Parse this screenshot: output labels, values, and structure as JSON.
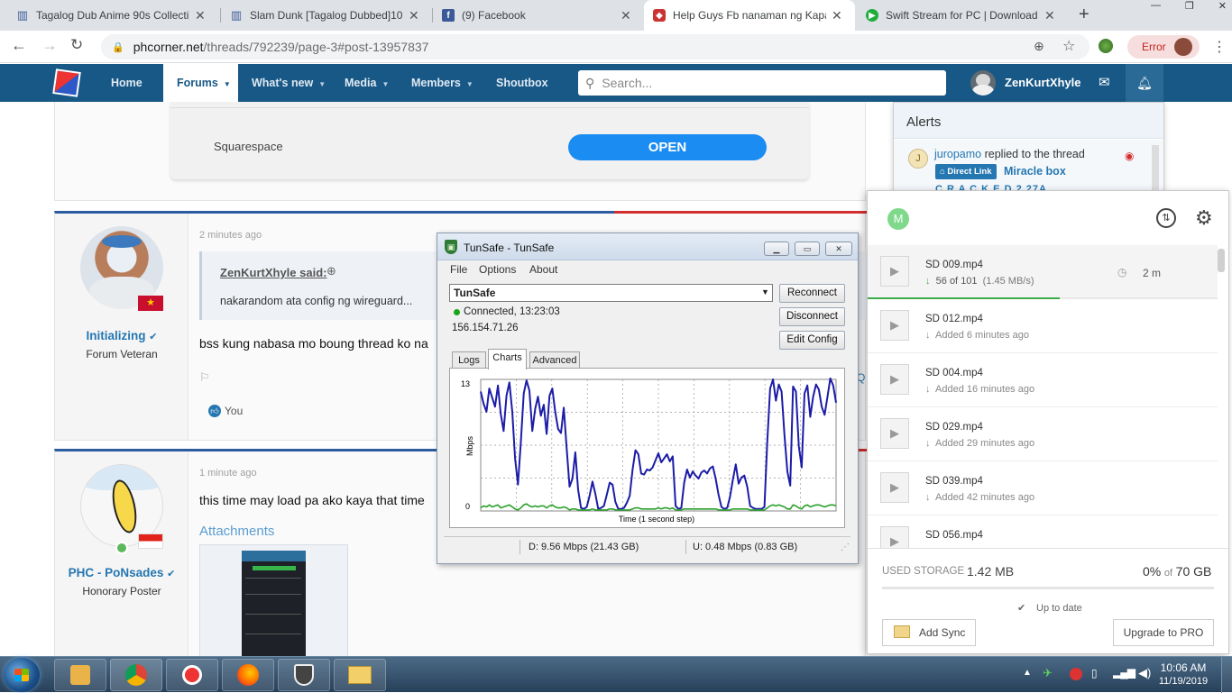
{
  "browser": {
    "tabs": [
      {
        "title": "Tagalog Dub Anime 90s Collecti",
        "icon": "mf-icon"
      },
      {
        "title": "Slam Dunk [Tagalog Dubbed]10",
        "icon": "mf-icon"
      },
      {
        "title": "(9) Facebook",
        "icon": "facebook-icon"
      },
      {
        "title": "Help Guys Fb nanaman ng Kapa",
        "icon": "phcorner-icon"
      },
      {
        "title": "Swift Stream for PC | Download",
        "icon": "swift-stream-icon"
      }
    ],
    "url_domain": "phcorner.net",
    "url_path": "/threads/792239/page-3#post-13957837",
    "error_label": "Error"
  },
  "site_nav": {
    "items": [
      "Home",
      "Forums",
      "What's new",
      "Media",
      "Members",
      "Shoutbox"
    ],
    "search_placeholder": "Search...",
    "username": "ZenKurtXhyle"
  },
  "ad": {
    "brand": "Squarespace",
    "button": "OPEN"
  },
  "posts": [
    {
      "username": "Initializing",
      "user_title": "Forum Veteran",
      "time": "2 minutes ago",
      "quote_author": "ZenKurtXhyle said:",
      "quote_text": "nakarandom ata config ng wireguard...",
      "body": "bss kung nabasa mo boung thread ko na",
      "reaction": "You",
      "overflow_char": "Q"
    },
    {
      "username": "PHC - PoNsades",
      "user_title": "Honorary Poster",
      "time": "1 minute ago",
      "body": "this time may load pa ako kaya that time",
      "attachments_label": "Attachments"
    }
  ],
  "alerts": {
    "title": "Alerts",
    "user": "juropamo",
    "action": "replied to the thread",
    "badge": "Direct Link",
    "thread": "Miracle box",
    "thread_cont": "C R A C K E D 2.27A"
  },
  "tunsafe": {
    "title": "TunSafe - TunSafe",
    "menu": [
      "File",
      "Options",
      "About"
    ],
    "config": "TunSafe",
    "status": "Connected, 13:23:03",
    "ip": "156.154.71.26",
    "buttons": [
      "Reconnect",
      "Disconnect",
      "Edit Config"
    ],
    "tabs": [
      "Logs",
      "Charts",
      "Advanced"
    ],
    "download": "D: 9.56 Mbps (21.43 GB)",
    "upload": "U: 0.48 Mbps (0.83 GB)",
    "status_color": "#1aa51a"
  },
  "chart_data": {
    "type": "line",
    "xlabel": "Time (1 second step)",
    "ylabel": "Mbps",
    "ylim": [
      0,
      13
    ],
    "yticks": [
      "13",
      "0"
    ],
    "grid": true,
    "series": [
      {
        "color": "#1c1ca8",
        "values": [
          11.8,
          10.6,
          9.8,
          12.1,
          11.2,
          10.3,
          12.4,
          9.6,
          7.9,
          11.4,
          12.7,
          9.8,
          5.2,
          2.6,
          6.8,
          11.6,
          12.9,
          11.9,
          7.9,
          10.1,
          11.3,
          9.4,
          10.5,
          7.6,
          11.4,
          12.1,
          9.8,
          8.1,
          7.7,
          10.2,
          6.2,
          2.4,
          3.2,
          5.8,
          2.1,
          0.3,
          0.2,
          0.4,
          1.5,
          2.9,
          1.7,
          0.2,
          0.3,
          0.5,
          1.6,
          2.8,
          2.6,
          0.9,
          0.2,
          0.2,
          0.3,
          0.8,
          1.5,
          4.1,
          6.0,
          5.6,
          3.7,
          3.6,
          4.1,
          4.0,
          4.3,
          5.0,
          5.7,
          4.8,
          5.2,
          5.6,
          4.9,
          5.4,
          0.5,
          0.2,
          0.3,
          2.8,
          4.1,
          3.3,
          3.9,
          3.5,
          3.2,
          3.8,
          4.0,
          3.7,
          4.2,
          4.4,
          3.2,
          1.6,
          0.4,
          0.2,
          0.3,
          1.4,
          3.1,
          4.6,
          2.7,
          3.3,
          3.5,
          2.4,
          0.5,
          0.3,
          0.2,
          0.2,
          0.2,
          0.4,
          6.8,
          12.1,
          13.0,
          10.9,
          12.5,
          11.8,
          7.5,
          3.9,
          2.5,
          12.3,
          11.8,
          6.4,
          4.3,
          11.6,
          12.4,
          9.3,
          11.3,
          12.5,
          12.0,
          10.3,
          9.5,
          11.3,
          13.1,
          12.4,
          10.7
        ]
      },
      {
        "color": "#2aa02a",
        "values": [
          0.3,
          0.5,
          0.4,
          0.6,
          0.4,
          0.5,
          0.6,
          0.3,
          0.4,
          0.5,
          0.6,
          0.4,
          0.2,
          0.1,
          0.3,
          0.6,
          0.7,
          0.5,
          0.4,
          0.5,
          0.4,
          0.5,
          0.5,
          0.3,
          0.5,
          0.6,
          0.4,
          0.3,
          0.3,
          0.4,
          0.3,
          0.1,
          0.2,
          0.2,
          0.1,
          0.1,
          0.1,
          0.1,
          0.1,
          0.2,
          0.1,
          0.1,
          0.1,
          0.1,
          0.1,
          0.2,
          0.2,
          0.1,
          0.1,
          0.1,
          0.1,
          0.1,
          0.1,
          0.2,
          0.3,
          0.3,
          0.2,
          0.2,
          0.2,
          0.2,
          0.2,
          0.2,
          0.3,
          0.2,
          0.3,
          0.3,
          0.2,
          0.3,
          0.1,
          0.1,
          0.1,
          0.2,
          0.2,
          0.2,
          0.2,
          0.2,
          0.2,
          0.2,
          0.2,
          0.2,
          0.2,
          0.2,
          0.2,
          0.1,
          0.1,
          0.1,
          0.1,
          0.1,
          0.2,
          0.2,
          0.2,
          0.2,
          0.2,
          0.2,
          0.1,
          0.1,
          0.1,
          0.1,
          0.1,
          0.1,
          0.3,
          0.5,
          0.6,
          0.5,
          0.6,
          0.5,
          0.4,
          0.2,
          0.2,
          0.6,
          0.5,
          0.3,
          0.2,
          0.5,
          0.6,
          0.4,
          0.5,
          0.6,
          0.6,
          0.5,
          0.4,
          0.5,
          0.6,
          0.6,
          0.5
        ]
      }
    ]
  },
  "sync": {
    "avatar_letter": "M",
    "files": [
      {
        "name": "SD 009.mp4",
        "progress": "56",
        "total": "101",
        "speed": "(1.45 MB/s)",
        "eta": "2 m",
        "progress_fraction": 0.55
      },
      {
        "name": "SD 012.mp4",
        "status": "Added 6 minutes ago"
      },
      {
        "name": "SD 004.mp4",
        "status": "Added 16 minutes ago"
      },
      {
        "name": "SD 029.mp4",
        "status": "Added 29 minutes ago"
      },
      {
        "name": "SD 039.mp4",
        "status": "Added 42 minutes ago"
      },
      {
        "name": "SD 056.mp4"
      }
    ],
    "of_word": "of",
    "storage_label": "USED STORAGE",
    "storage_used": "1.42 MB",
    "storage_pct": "0%",
    "storage_of": "of",
    "storage_total": "70 GB",
    "up_to_date": "Up to date",
    "add_sync": "Add Sync",
    "upgrade": "Upgrade to PRO"
  },
  "taskbar": {
    "time": "10:06 AM",
    "date": "11/19/2019"
  }
}
